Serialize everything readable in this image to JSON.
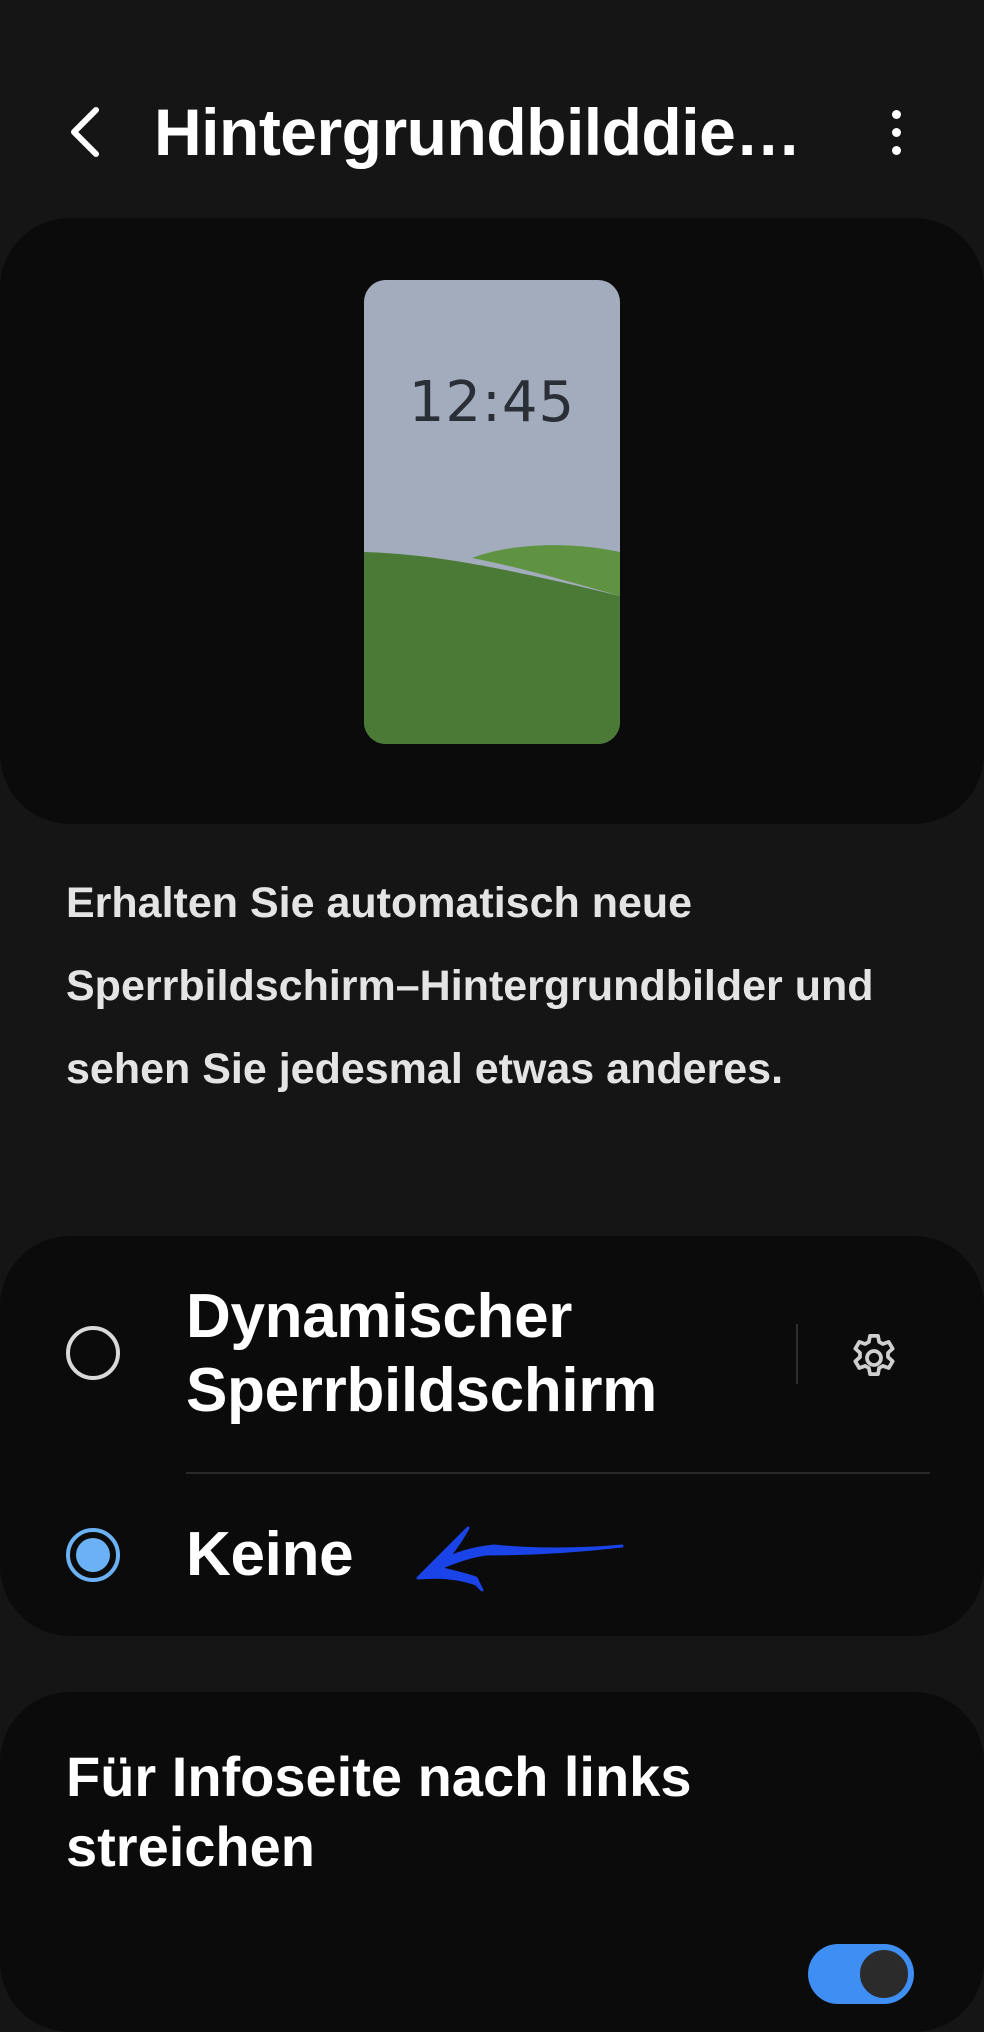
{
  "header": {
    "title": "Hintergrundbilddien…",
    "back_icon": "chevron-left-icon",
    "more_icon": "more-vertical-icon"
  },
  "preview": {
    "clock": "12:45",
    "sky_color": "#a2acbc",
    "hill_colors": [
      "#4a7a35",
      "#5f9342"
    ]
  },
  "description": "Erhalten Sie automatisch neue Sperrbildschirm–Hintergrundbilder und sehen Sie jedesmal etwas anderes.",
  "options": [
    {
      "label_line1": "Dynamischer",
      "label_line2": "Sperrbildschirm",
      "selected": false,
      "settings_icon": "gear-icon"
    },
    {
      "label": "Keine",
      "selected": true
    }
  ],
  "annotation": {
    "icon": "hand-drawn-arrow-icon",
    "color": "#1a43e8"
  },
  "swipe_setting": {
    "label": "Für Infoseite nach links streichen",
    "toggle_on": true
  },
  "colors": {
    "background": "#151515",
    "card": "#0b0b0b",
    "accent": "#3f8ef3",
    "radio_accent": "#6ab2f5"
  }
}
